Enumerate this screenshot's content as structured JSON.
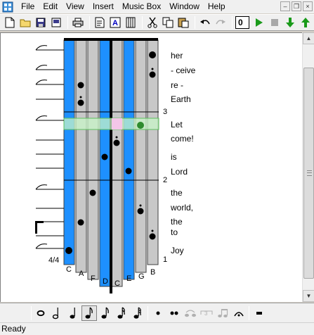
{
  "menu": [
    "File",
    "Edit",
    "View",
    "Insert",
    "Music Box",
    "Window",
    "Help"
  ],
  "toolbar": {
    "tempo_value": "0",
    "icons": [
      "new-file-icon",
      "open-folder-icon",
      "save-icon",
      "save-as-icon",
      "print-icon",
      "properties-icon",
      "text-icon",
      "keyboard-icon",
      "cut-icon",
      "copy-icon",
      "paste-icon",
      "undo-icon",
      "redo-icon",
      "play-icon",
      "stop-icon",
      "down-arrow-icon",
      "up-arrow-icon"
    ]
  },
  "kalimba": {
    "tine_labels": [
      "C",
      "A",
      "F",
      "D",
      "C",
      "E",
      "G",
      "B"
    ],
    "tine_colors": [
      "#1e90ff",
      "#c8c8c8",
      "#c8c8c8",
      "#1e90ff",
      "#c8c8c8",
      "#1e90ff",
      "#c8c8c8",
      "#c8c8c8"
    ],
    "time_signature": "4/4",
    "measure_numbers": [
      "3",
      "2",
      "1"
    ],
    "lyrics": [
      "her",
      "- ceive",
      "re -",
      "Earth",
      "Let",
      "come!",
      "is",
      "Lord",
      "the",
      "world,",
      "the",
      "to",
      "Joy"
    ],
    "colors": {
      "blue_tine": "#1e90ff",
      "gray_tine": "#c8c8c8",
      "highlight": "#c8f5c8",
      "selected_note": "#2e8b2e",
      "pink_cell": "#f4c6e8"
    }
  },
  "status": "Ready"
}
